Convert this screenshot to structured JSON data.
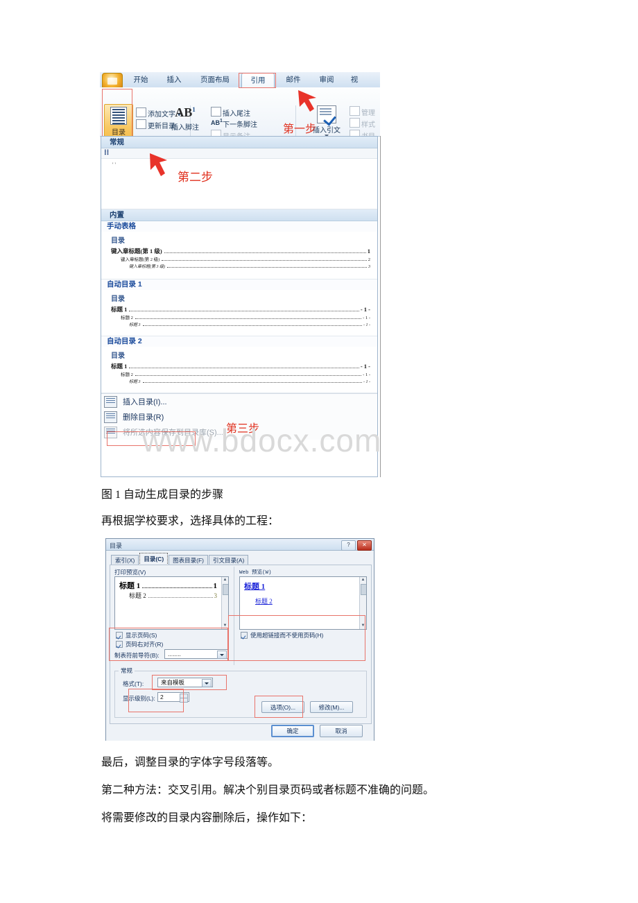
{
  "document": {
    "paragraphs": [
      {
        "id": "caption1",
        "text": "图 1 自动生成目录的步骤"
      },
      {
        "id": "para1",
        "text": "再根据学校要求，选择具体的工程："
      },
      {
        "id": "para2",
        "text": "最后，调整目录的字体字号段落等。"
      },
      {
        "id": "para3",
        "text": "第二种方法：交叉引用。解决个别目录页码或者标题不准确的问题。"
      },
      {
        "id": "para4",
        "text": "将需要修改的目录内容删除后，操作如下："
      }
    ],
    "watermark": "www.bdocx.com"
  },
  "figure1": {
    "ribbon": {
      "office_button": "office-orb",
      "tabs": [
        {
          "label": "开始",
          "selected": false
        },
        {
          "label": "插入",
          "selected": false
        },
        {
          "label": "页面布局",
          "selected": false
        },
        {
          "label": "引用",
          "selected": true
        },
        {
          "label": "邮件",
          "selected": false
        },
        {
          "label": "审阅",
          "selected": false
        },
        {
          "label": "视",
          "selected": false
        }
      ],
      "toc_button": {
        "label": "目录",
        "dropdown": "▾"
      },
      "toc_group_items": [
        {
          "label": "添加文字 ▾",
          "disabled": false
        },
        {
          "label": "更新目录",
          "disabled": false
        }
      ],
      "footnote_group": {
        "big_label": "AB",
        "big_sup": "1",
        "caption": "插入脚注",
        "items": [
          {
            "label": "插入尾注",
            "disabled": false
          },
          {
            "label": "下一条脚注",
            "disabled": false,
            "sup": "1"
          },
          {
            "label": "显示备注",
            "disabled": true
          }
        ]
      },
      "citation_group": {
        "caption": "插入引文",
        "items": [
          {
            "label": "管理",
            "disabled": true
          },
          {
            "label": "样式",
            "disabled": true
          },
          {
            "label": "书目",
            "disabled": true
          }
        ]
      }
    },
    "annotations": [
      {
        "id": "step1",
        "text": "第一步"
      },
      {
        "id": "step2",
        "text": "第二步"
      },
      {
        "id": "step3",
        "text": "第三步"
      }
    ],
    "gallery": {
      "categories": [
        {
          "label": "常规"
        },
        {
          "label": "内置"
        }
      ],
      "entries": [
        {
          "name": "手动表格",
          "title": "目录",
          "lines": [
            {
              "text": "键入章标题(第 1 级)",
              "page": "1",
              "level": 1
            },
            {
              "text": "键入章标题(第 2 级)",
              "page": "2",
              "level": 2
            },
            {
              "text": "键入章标题(第 3 级)",
              "page": "3",
              "level": 3
            }
          ]
        },
        {
          "name": "自动目录 1",
          "title": "目录",
          "lines": [
            {
              "text": "标题 1",
              "page": "- 1 -",
              "level": 1
            },
            {
              "text": "标题 2",
              "page": "- 1 -",
              "level": 2
            },
            {
              "text": "标题 3",
              "page": "- 1 -",
              "level": 3
            }
          ]
        },
        {
          "name": "自动目录 2",
          "title": "目录",
          "lines": [
            {
              "text": "标题 1",
              "page": "- 1 -",
              "level": 1
            },
            {
              "text": "标题 2",
              "page": "- 1 -",
              "level": 2
            },
            {
              "text": "标题 3",
              "page": "- 1 -",
              "level": 3
            }
          ]
        }
      ],
      "menu_items": [
        {
          "label": "插入目录(I)...",
          "accel": "I",
          "disabled": false,
          "highlighted": true
        },
        {
          "label": "删除目录(R)",
          "accel": "R",
          "disabled": false,
          "highlighted": false
        },
        {
          "label": "将所选内容保存到目录库(S)...",
          "accel": "S",
          "disabled": true,
          "highlighted": false
        }
      ]
    }
  },
  "figure2": {
    "title": "目录",
    "window_buttons": [
      {
        "name": "help-button",
        "glyph": "?"
      },
      {
        "name": "close-button",
        "glyph": "✕"
      }
    ],
    "tabs": [
      {
        "label": "索引(X)",
        "selected": false
      },
      {
        "label": "目录(C)",
        "selected": true
      },
      {
        "label": "图表目录(F)",
        "selected": false
      },
      {
        "label": "引文目录(A)",
        "selected": false
      }
    ],
    "print_preview": {
      "label": "打印预览(V)",
      "lines": [
        {
          "text": "标题 1",
          "page": "1",
          "level": 1
        },
        {
          "text": "标题 2",
          "page": "3",
          "level": 2
        }
      ]
    },
    "web_preview": {
      "label": "Web 预览(W)",
      "lines": [
        {
          "text": "标题 1",
          "level": 1
        },
        {
          "text": "标题 2",
          "level": 2
        }
      ]
    },
    "checkboxes": [
      {
        "label": "显示页码(S)",
        "checked": true
      },
      {
        "label": "页码右对齐(R)",
        "checked": true
      },
      {
        "label": "使用超链接而不使用页码(H)",
        "checked": true
      }
    ],
    "tab_leader": {
      "label": "制表符前导符(B):",
      "value": "........"
    },
    "general": {
      "group_label": "常规",
      "format": {
        "label": "格式(T):",
        "value": "来自模板"
      },
      "levels": {
        "label": "显示级别(L):",
        "value": "2"
      }
    },
    "buttons": [
      {
        "label": "选项(O)...",
        "name": "options-button",
        "default": false
      },
      {
        "label": "修改(M)...",
        "name": "modify-button",
        "default": false
      },
      {
        "label": "确定",
        "name": "ok-button",
        "default": true
      },
      {
        "label": "取消",
        "name": "cancel-button",
        "default": false
      }
    ]
  },
  "colors": {
    "accent_red": "#e0301e",
    "highlight_box": "#e8736a",
    "ribbon_tab_text": "#1c3c61",
    "link_blue": "#1c25d8"
  }
}
